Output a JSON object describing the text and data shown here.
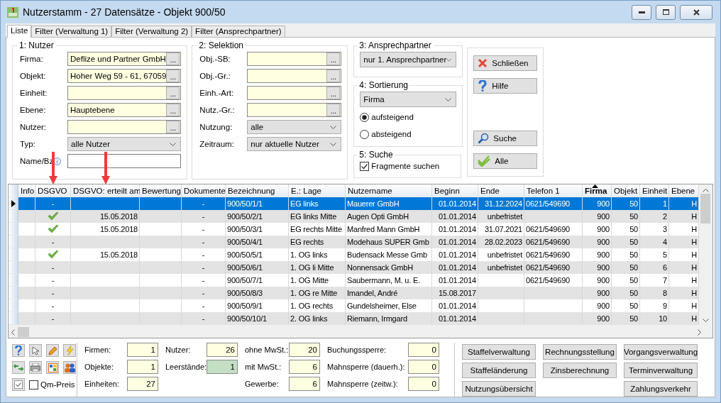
{
  "window": {
    "title": "Nutzerstamm - 27 Datensätze - Objekt 900/50"
  },
  "tabs": [
    {
      "label": "Liste",
      "selected": true
    },
    {
      "label": "Filter (Verwaltung 1)",
      "selected": false
    },
    {
      "label": "Filter (Verwaltung 2)",
      "selected": false
    },
    {
      "label": "Filter (Ansprechpartner)",
      "selected": false
    }
  ],
  "nutzer": {
    "title": "1: Nutzer",
    "fields": [
      {
        "kind": "lookup",
        "label": "Firma:",
        "value": "Deflize und Partner GmbH",
        "button": "..."
      },
      {
        "kind": "lookup",
        "label": "Objekt:",
        "value": "Hoher Weg 59 - 61, 67059",
        "button": "..."
      },
      {
        "kind": "lookup",
        "label": "Einheit:",
        "button": "..."
      },
      {
        "kind": "lookup",
        "label": "Ebene:",
        "value": "Hauptebene",
        "button": "..."
      },
      {
        "kind": "lookup",
        "label": "Nutzer:",
        "button": "..."
      },
      {
        "kind": "select",
        "label": "Typ:",
        "value": "alle Nutzer"
      },
      {
        "kind": "text",
        "label": "Name/Bz",
        "info": true
      }
    ]
  },
  "selektion": {
    "title": "2: Selektion",
    "fields": [
      {
        "kind": "lookup",
        "label": "Obj.-SB:",
        "button": "..."
      },
      {
        "kind": "lookup",
        "label": "Obj.-Gr.:",
        "button": "..."
      },
      {
        "kind": "lookup",
        "label": "Einh.-Art:",
        "button": "..."
      },
      {
        "kind": "lookup",
        "label": "Nutz.-Gr.:",
        "button": "..."
      },
      {
        "kind": "select",
        "label": "Nutzung:",
        "value": "alle"
      },
      {
        "kind": "select",
        "label": "Zeitraum:",
        "value": "nur aktuelle Nutzer"
      }
    ]
  },
  "ansprechpartner": {
    "title": "3: Ansprechpartner",
    "value": "nur 1. Ansprechpartner"
  },
  "sortierung": {
    "title": "4: Sortierung",
    "value": "Firma",
    "options": [
      {
        "label": "aufsteigend",
        "selected": true
      },
      {
        "label": "absteigend",
        "selected": false
      }
    ]
  },
  "suche": {
    "title": "5: Suche",
    "checkbox": {
      "label": "Fragmente suchen",
      "checked": true
    }
  },
  "actions_top": [
    {
      "kind": "close",
      "label": "Schließen"
    },
    {
      "kind": "help",
      "label": "Hilfe"
    }
  ],
  "actions_bottom": [
    {
      "kind": "search",
      "label": "Suche"
    },
    {
      "kind": "check",
      "label": "Alle"
    }
  ],
  "table": {
    "columns": [
      {
        "label": "Info",
        "marked": false,
        "sorted": false
      },
      {
        "label": "DSGVO",
        "marked": true,
        "sorted": false
      },
      {
        "label": "DSGVO: erteilt am",
        "marked": true,
        "sorted": false
      },
      {
        "label": "Bewertung",
        "marked": false,
        "sorted": false
      },
      {
        "label": "Dokumente",
        "marked": false,
        "sorted": false
      },
      {
        "label": "Bezeichnung",
        "marked": false,
        "sorted": false
      },
      {
        "label": "E.: Lage",
        "marked": false,
        "sorted": false
      },
      {
        "label": "Nutzername",
        "marked": false,
        "sorted": false
      },
      {
        "label": "Beginn",
        "marked": false,
        "sorted": false
      },
      {
        "label": "Ende",
        "marked": false,
        "sorted": false
      },
      {
        "label": "Telefon 1",
        "marked": false,
        "sorted": false
      },
      {
        "label": "Firma",
        "marked": false,
        "sorted": true
      },
      {
        "label": "Objekt",
        "marked": false,
        "sorted": false
      },
      {
        "label": "Einheit",
        "marked": false,
        "sorted": false
      },
      {
        "label": "Ebene",
        "marked": false,
        "sorted": false
      }
    ],
    "rows": [
      {
        "selected": true,
        "dsgvo_granted": false,
        "cells": [
          null,
          "-",
          null,
          null,
          "-",
          "900/50/1/1",
          "EG links",
          "Mauerer GmbH",
          "01.01.2014",
          "31.12.2024",
          "0621/549690",
          "900",
          "50",
          "1",
          "H"
        ]
      },
      {
        "selected": false,
        "dsgvo_granted": true,
        "cells": [
          null,
          null,
          "15.05.2018",
          null,
          "-",
          "900/50/2/1",
          "EG links Mitte",
          "Augen Opti GmbH",
          "01.01.2014",
          "unbefristet",
          null,
          "900",
          "50",
          "2",
          "H"
        ]
      },
      {
        "selected": false,
        "dsgvo_granted": true,
        "cells": [
          null,
          null,
          "15.05.2018",
          null,
          "-",
          "900/50/3/1",
          "EG rechts Mitte",
          "Manfred Mann GmbH",
          "01.01.2014",
          "31.07.2021",
          "0621/549690",
          "900",
          "50",
          "3",
          "H"
        ]
      },
      {
        "selected": false,
        "dsgvo_granted": false,
        "cells": [
          null,
          "-",
          null,
          null,
          "-",
          "900/50/4/1",
          "EG rechts",
          "Modehaus SUPER Gmb",
          "01.01.2014",
          "28.02.2023",
          "0621/549690",
          "900",
          "50",
          "4",
          "H"
        ]
      },
      {
        "selected": false,
        "dsgvo_granted": true,
        "cells": [
          null,
          null,
          "15.05.2018",
          null,
          "-",
          "900/50/5/1",
          "1. OG links",
          "Budensack Messe Gmb",
          "01.01.2014",
          "unbefristet",
          "0621/549690",
          "900",
          "50",
          "5",
          "H"
        ]
      },
      {
        "selected": false,
        "dsgvo_granted": false,
        "cells": [
          null,
          "-",
          null,
          null,
          "-",
          "900/50/6/1",
          "1. OG li Mitte",
          "Nonnensack GmbH",
          "01.01.2014",
          "unbefristet",
          "0621/549690",
          "900",
          "50",
          "6",
          "H"
        ]
      },
      {
        "selected": false,
        "dsgvo_granted": false,
        "cells": [
          null,
          "-",
          null,
          null,
          "-",
          "900/50/7/1",
          "1. OG Mitte",
          "Saubermann, M. u. E.",
          "01.01.2014",
          null,
          "0621/549690",
          "900",
          "50",
          "7",
          "H"
        ]
      },
      {
        "selected": false,
        "dsgvo_granted": false,
        "cells": [
          null,
          "-",
          null,
          null,
          "-",
          "900/50/8/3",
          "1. OG re Mitte",
          "Imandel, André",
          "15.08.2017",
          null,
          null,
          "900",
          "50",
          "8",
          "H"
        ]
      },
      {
        "selected": false,
        "dsgvo_granted": false,
        "cells": [
          null,
          "-",
          null,
          null,
          "-",
          "900/50/9/1",
          "1. OG rechts",
          "Gundelsheimer, Else",
          "01.01.2014",
          null,
          null,
          "900",
          "50",
          "9",
          "H"
        ]
      },
      {
        "selected": false,
        "dsgvo_granted": false,
        "cells": [
          null,
          "-",
          null,
          null,
          "-",
          "900/50/10/1",
          "2. OG links",
          "Riemann, Irmgard",
          "01.01.2014",
          null,
          null,
          "900",
          "50",
          "10",
          "H"
        ]
      }
    ]
  },
  "tools": [
    {
      "kind": "help"
    },
    {
      "kind": "cursor"
    },
    {
      "kind": "pencil"
    },
    {
      "kind": "lightning"
    },
    {
      "kind": "arrows"
    },
    {
      "kind": "printer"
    },
    {
      "kind": "grid"
    },
    {
      "kind": "people"
    },
    {
      "kind": "check"
    }
  ],
  "qm_preis": {
    "label": "Qm-Preis",
    "checked": false
  },
  "stats": [
    [
      {
        "label": "Firmen:",
        "value": "1",
        "highlight": false
      },
      {
        "label": "Objekte:",
        "value": "1",
        "highlight": false
      },
      {
        "label": "Einheiten:",
        "value": "27",
        "highlight": false
      }
    ],
    [
      {
        "label": "Nutzer:",
        "value": "26",
        "highlight": false
      },
      {
        "label": "Leerstände:",
        "value": "1",
        "highlight": true
      }
    ],
    [
      {
        "label": "ohne MwSt.:",
        "value": "20",
        "highlight": false
      },
      {
        "label": "mit MwSt.:",
        "value": "6",
        "highlight": false
      },
      {
        "label": "Gewerbe:",
        "value": "6",
        "highlight": false
      }
    ],
    [
      {
        "label": "Buchungssperre:",
        "value": "0",
        "highlight": false
      },
      {
        "label": "Mahnsperre (dauerh.):",
        "value": "0",
        "highlight": false
      },
      {
        "label": "Mahnsperre (zeitw.):",
        "value": "0",
        "highlight": false
      }
    ]
  ],
  "buttons": [
    [
      "Staffelverwaltung",
      "Staffeländerung",
      "Nutzungsübersicht"
    ],
    [
      "Rechnungsstellung",
      "Zinsberechnung"
    ],
    [
      "Vorgangsverwaltung",
      "Terminverwaltung",
      "Zahlungsverkehr"
    ]
  ]
}
